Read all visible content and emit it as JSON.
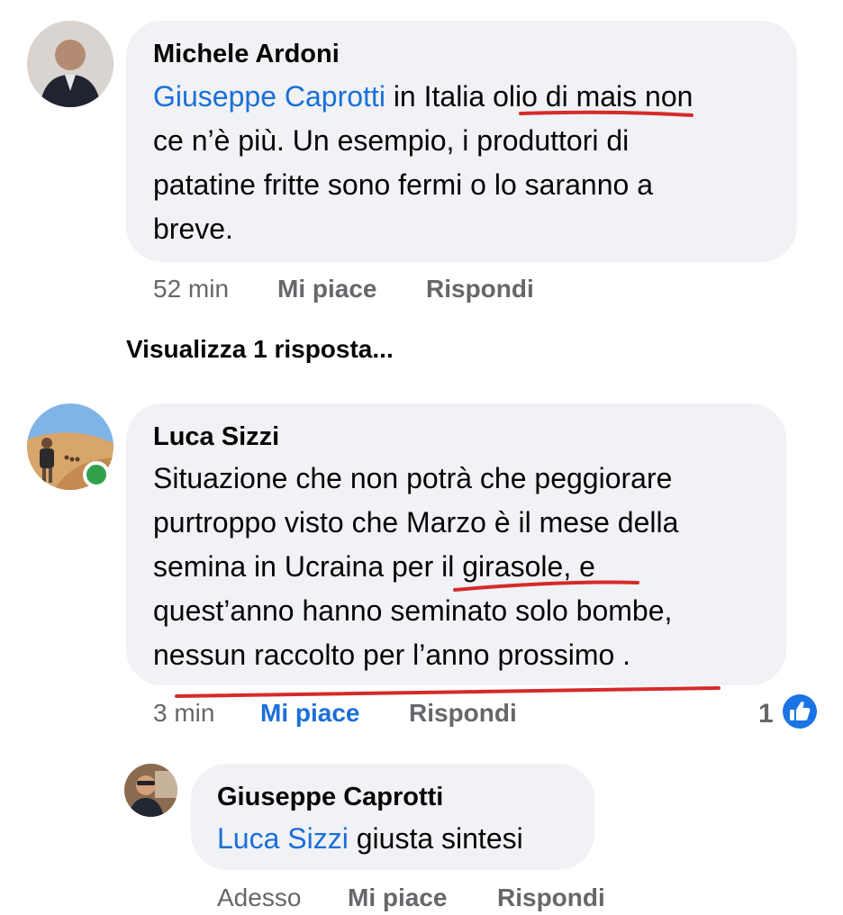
{
  "comments": [
    {
      "author": "Michele Ardoni",
      "mention": "Giuseppe Caprotti",
      "text_lines": [
        " in Italia olio di mais non",
        "ce n’è più. Un esempio, i produttori di",
        "patatine fritte sono fermi o lo saranno a",
        "breve."
      ],
      "time": "52 min",
      "like_label": "Mi piace",
      "reply_label": "Rispondi"
    },
    {
      "view_replies": "Visualizza 1 risposta..."
    },
    {
      "author": "Luca Sizzi",
      "text_lines": [
        "Situazione che non potrà che peggiorare",
        "purtroppo visto che Marzo è il mese della",
        "semina in Ucraina per il girasole, e",
        "quest’anno hanno seminato solo bombe,",
        "nessun raccolto per l’anno prossimo ."
      ],
      "time": "3 min",
      "like_label": "Mi piace",
      "reply_label": "Rispondi",
      "reaction_count": "1",
      "online": true
    },
    {
      "author": "Giuseppe Caprotti",
      "mention": "Luca Sizzi",
      "text": " giusta sintesi",
      "time": "Adesso",
      "like_label": "Mi piace",
      "reply_label": "Rispondi"
    }
  ],
  "colors": {
    "bubble": "#f0f2f5",
    "mention": "#1b6fd8",
    "meta": "#65676b",
    "underline_annotation": "#d62a2a",
    "online_dot": "#31a24c"
  },
  "icons": [
    "like-thumb-icon",
    "online-status-icon"
  ]
}
